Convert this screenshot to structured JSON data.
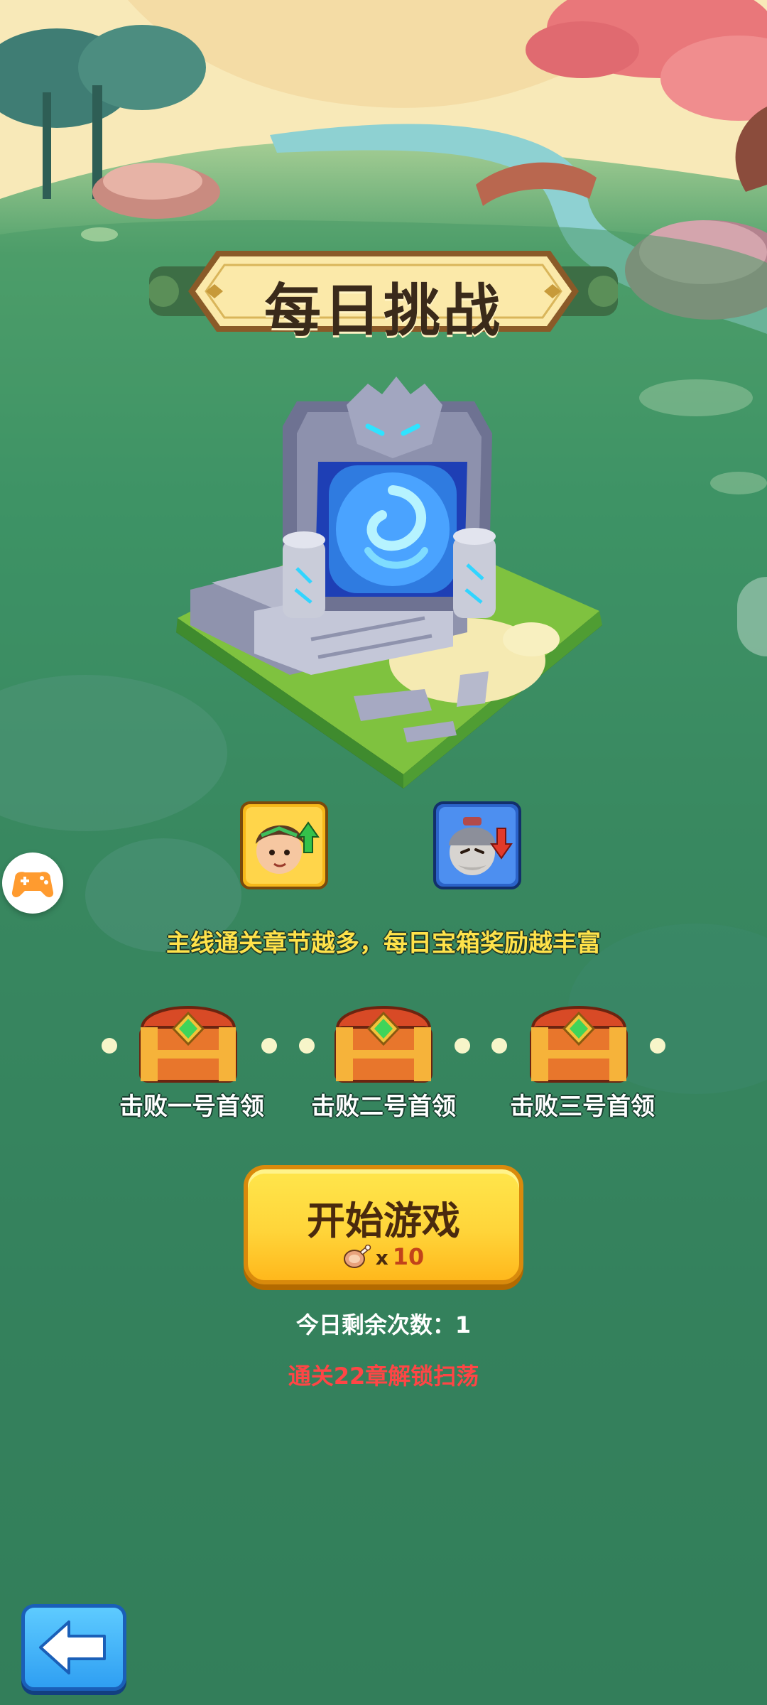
{
  "title": "每日挑战",
  "hint": "主线通关章节越多，每日宝箱奖励越丰富",
  "roles": [
    {
      "icon": "hero-up-icon"
    },
    {
      "icon": "boss-down-icon"
    }
  ],
  "chests": [
    {
      "label": "击败一号首领"
    },
    {
      "label": "击败二号首领"
    },
    {
      "label": "击败三号首领"
    }
  ],
  "start": {
    "label": "开始游戏",
    "cost_x": "x",
    "cost_value": "10"
  },
  "remaining_text": "今日剩余次数：1",
  "unlock_text": "通关22章解锁扫荡",
  "colors": {
    "hint": "#ffe24a",
    "unlock": "#ff4545",
    "button": "#ffd53a",
    "back": "#2f9ff2"
  }
}
